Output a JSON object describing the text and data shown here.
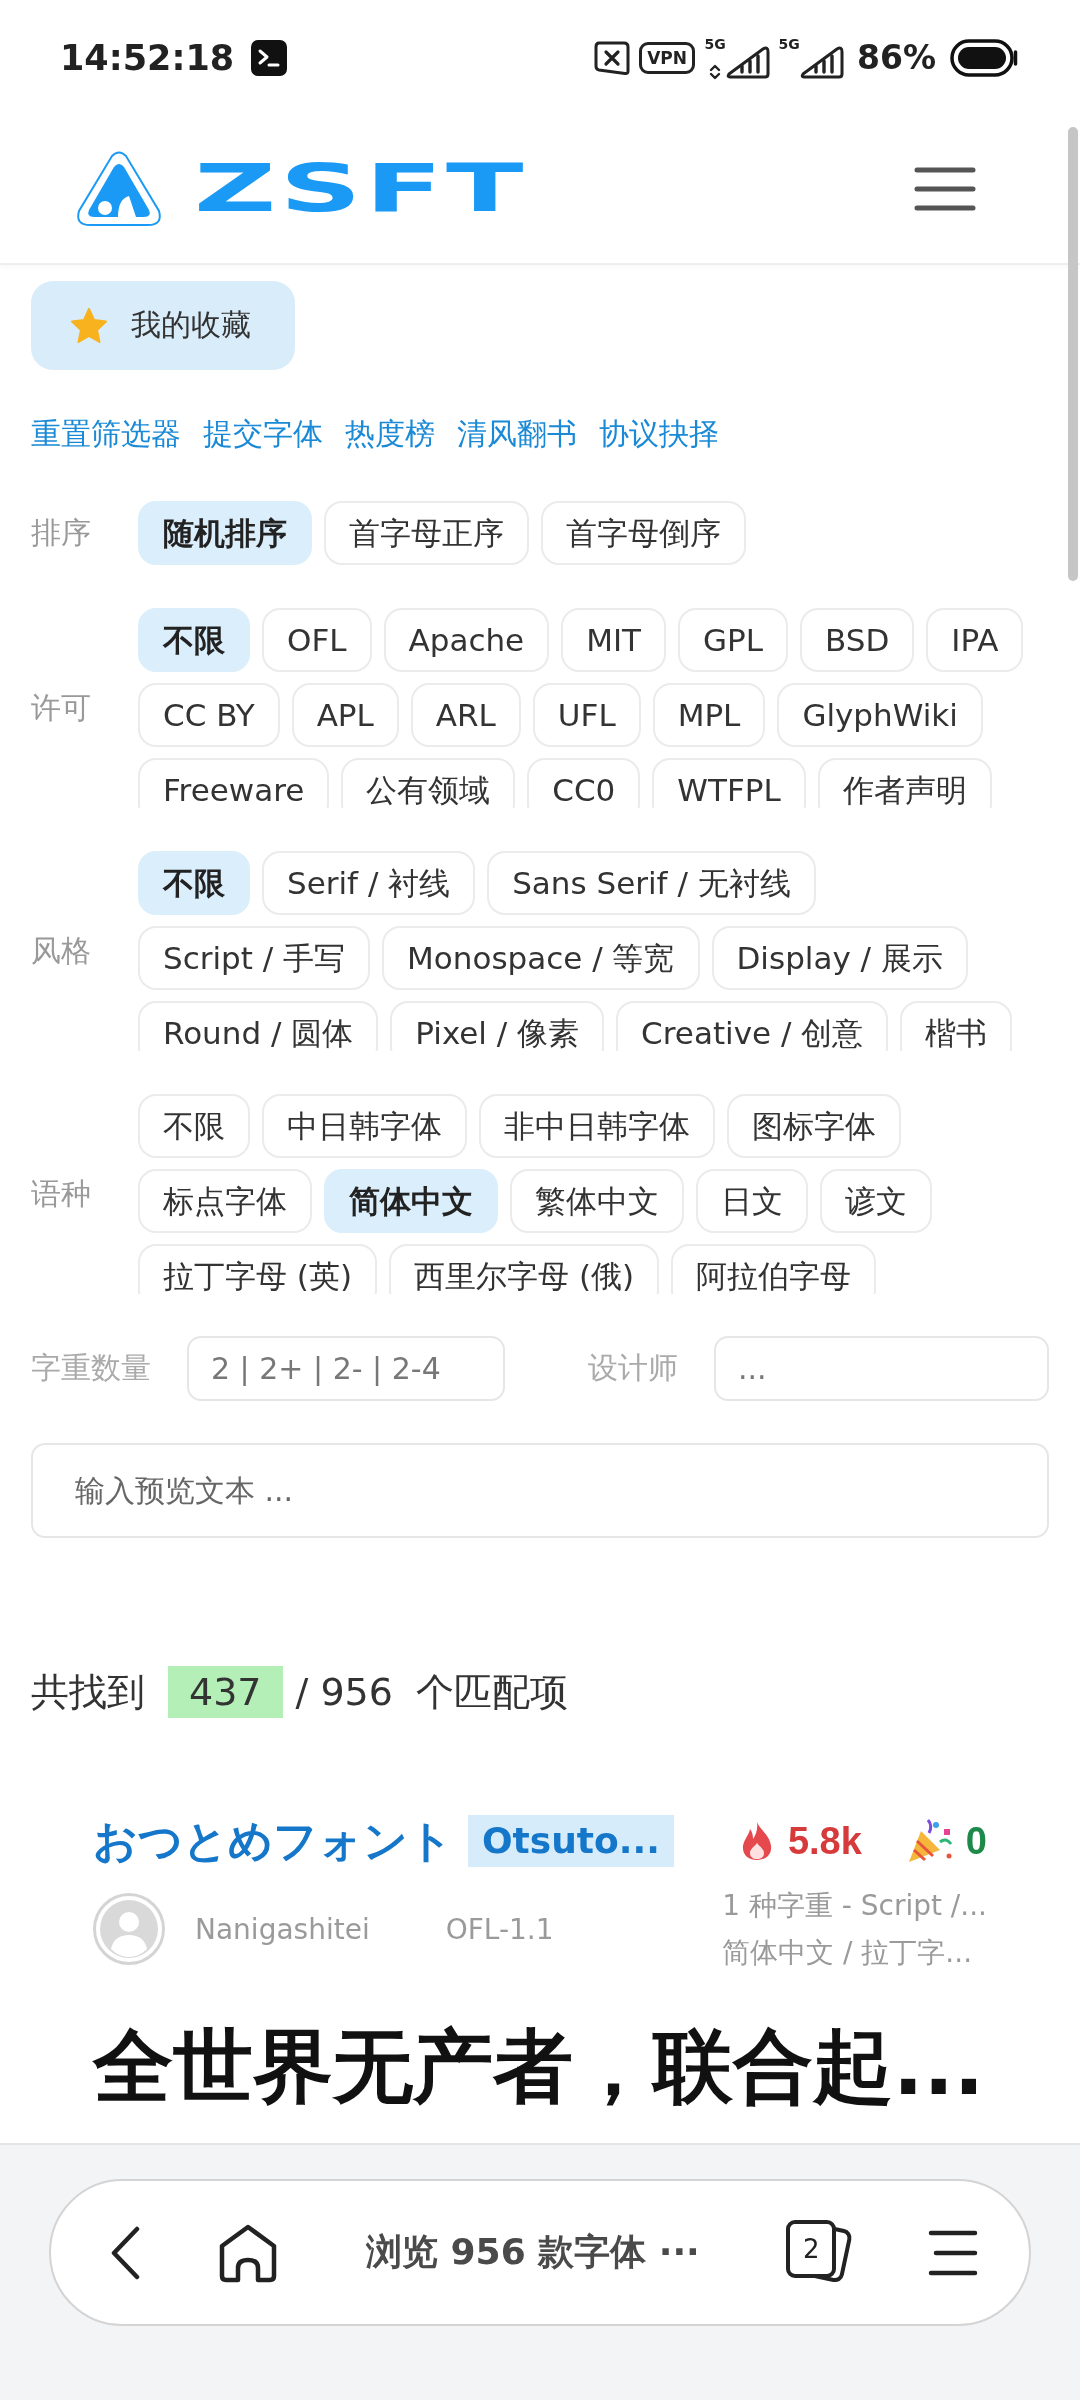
{
  "status_bar": {
    "time": "14:52:18",
    "vpn": "VPN",
    "networks": [
      {
        "label": "5G",
        "data_arrows": true
      },
      {
        "label": "5G",
        "data_arrows": false
      }
    ],
    "battery": "86%"
  },
  "header": {
    "logo_text": "ZSFT"
  },
  "favorites": {
    "label": "我的收藏"
  },
  "links": [
    "重置筛选器",
    "提交字体",
    "热度榜",
    "清风翻书",
    "协议抉择"
  ],
  "filters": [
    {
      "label": "排序",
      "options": [
        {
          "label": "随机排序",
          "selected": true
        },
        {
          "label": "首字母正序",
          "selected": false
        },
        {
          "label": "首字母倒序",
          "selected": false
        }
      ]
    },
    {
      "label": "许可",
      "options": [
        {
          "label": "不限",
          "selected": true
        },
        {
          "label": "OFL",
          "selected": false
        },
        {
          "label": "Apache",
          "selected": false
        },
        {
          "label": "MIT",
          "selected": false
        },
        {
          "label": "GPL",
          "selected": false
        },
        {
          "label": "BSD",
          "selected": false
        },
        {
          "label": "IPA",
          "selected": false
        },
        {
          "label": "CC BY",
          "selected": false
        },
        {
          "label": "APL",
          "selected": false
        },
        {
          "label": "ARL",
          "selected": false
        },
        {
          "label": "UFL",
          "selected": false
        },
        {
          "label": "MPL",
          "selected": false
        },
        {
          "label": "GlyphWiki",
          "selected": false
        },
        {
          "label": "Freeware",
          "selected": false
        },
        {
          "label": "公有领域",
          "selected": false
        },
        {
          "label": "CC0",
          "selected": false
        },
        {
          "label": "WTFPL",
          "selected": false
        },
        {
          "label": "作者声明",
          "selected": false
        }
      ]
    },
    {
      "label": "风格",
      "options": [
        {
          "label": "不限",
          "selected": true
        },
        {
          "label": "Serif / 衬线",
          "selected": false
        },
        {
          "label": "Sans Serif / 无衬线",
          "selected": false
        },
        {
          "label": "Script / 手写",
          "selected": false
        },
        {
          "label": "Monospace / 等宽",
          "selected": false
        },
        {
          "label": "Display / 展示",
          "selected": false
        },
        {
          "label": "Round / 圆体",
          "selected": false
        },
        {
          "label": "Pixel / 像素",
          "selected": false
        },
        {
          "label": "Creative / 创意",
          "selected": false
        },
        {
          "label": "楷书",
          "selected": false
        }
      ]
    },
    {
      "label": "语种",
      "options": [
        {
          "label": "不限",
          "selected": false
        },
        {
          "label": "中日韩字体",
          "selected": false
        },
        {
          "label": "非中日韩字体",
          "selected": false
        },
        {
          "label": "图标字体",
          "selected": false
        },
        {
          "label": "标点字体",
          "selected": false
        },
        {
          "label": "简体中文",
          "selected": true
        },
        {
          "label": "繁体中文",
          "selected": false
        },
        {
          "label": "日文",
          "selected": false
        },
        {
          "label": "谚文",
          "selected": false
        },
        {
          "label": "拉丁字母 (英)",
          "selected": false
        },
        {
          "label": "西里尔字母 (俄)",
          "selected": false
        },
        {
          "label": "阿拉伯字母",
          "selected": false
        }
      ]
    }
  ],
  "fields": [
    {
      "label": "字重数量",
      "placeholder": "2 | 2+ | 2- | 2-4"
    },
    {
      "label": "设计师",
      "placeholder": "..."
    }
  ],
  "preview_input": {
    "placeholder": "输入预览文本 ..."
  },
  "results": {
    "prefix": "共找到",
    "matched": "437",
    "total": "/ 956",
    "suffix": "个匹配项"
  },
  "font_card": {
    "name": "おつとめフォント",
    "latin_name": "Otsuto...",
    "popularity": "5.8k",
    "likes": "0",
    "designer": "Nanigashitei",
    "license": "OFL-1.1",
    "tags": [
      "1 种字重 - Script /...",
      "简体中文 / 拉丁字..."
    ],
    "preview": "全世界无产者，联合起..."
  },
  "browser_bar": {
    "title": "浏览 956 款字体 ···",
    "tab_count": "2"
  }
}
